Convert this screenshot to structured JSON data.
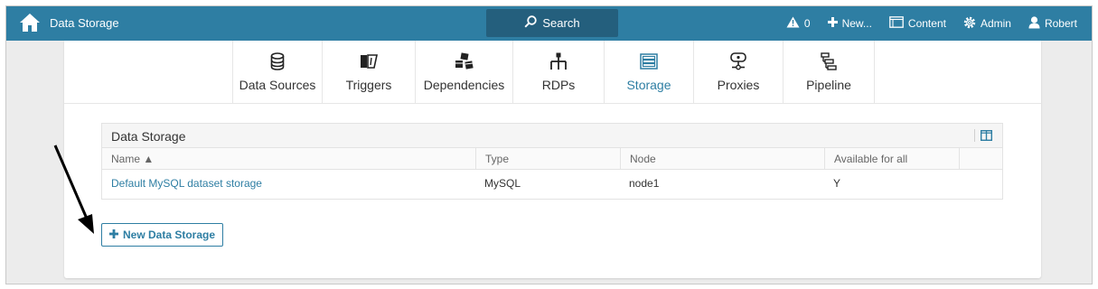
{
  "navbar": {
    "title": "Data Storage",
    "search_label": "Search",
    "alerts_count": "0",
    "new_label": "New...",
    "content_label": "Content",
    "admin_label": "Admin",
    "user_label": "Robert"
  },
  "tabs": [
    {
      "label": "Data Sources",
      "icon": "database-icon"
    },
    {
      "label": "Triggers",
      "icon": "triggers-icon"
    },
    {
      "label": "Dependencies",
      "icon": "cubes-icon"
    },
    {
      "label": "RDPs",
      "icon": "sitemap-icon"
    },
    {
      "label": "Storage",
      "icon": "storage-icon",
      "active": true
    },
    {
      "label": "Proxies",
      "icon": "proxy-icon"
    },
    {
      "label": "Pipeline",
      "icon": "pipeline-icon"
    }
  ],
  "panel": {
    "title": "Data Storage",
    "columns": [
      "Name ▲",
      "Type",
      "Node",
      "Available for all"
    ],
    "rows": [
      {
        "name": "Default MySQL dataset storage",
        "type": "MySQL",
        "node": "node1",
        "available": "Y"
      }
    ]
  },
  "new_button_label": "New Data Storage",
  "colors": {
    "accent": "#2e7ea3",
    "accent_dark": "#245f7d",
    "background": "#ececec"
  }
}
